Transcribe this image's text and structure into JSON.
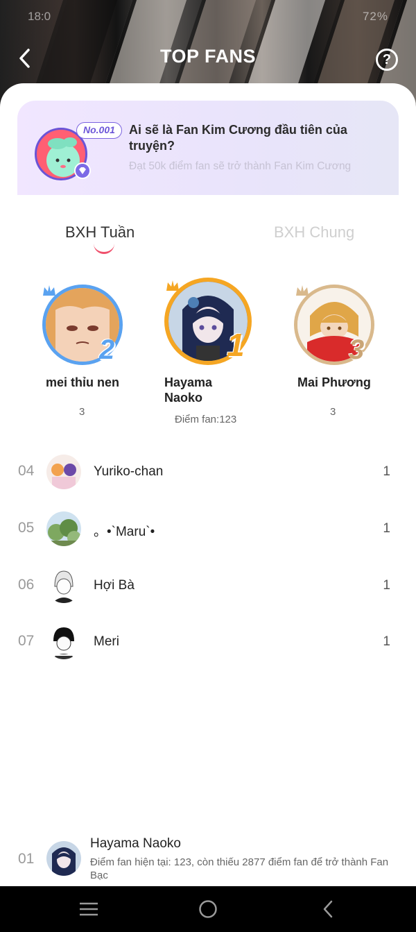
{
  "status_bar": {
    "time": "18:0",
    "right": "72%"
  },
  "header": {
    "title": "TOP FANS",
    "help_glyph": "?"
  },
  "banner": {
    "badge": "No.001",
    "title": "Ai sẽ là Fan Kim Cương đầu tiên của truyện?",
    "subtitle": "Đạt 50k điểm fan sẽ trở thành Fan Kim Cương"
  },
  "tabs": [
    {
      "label": "BXH Tuần",
      "active": true
    },
    {
      "label": "BXH Chung",
      "active": false
    }
  ],
  "podium": [
    {
      "rank": "2",
      "name": "mei thỉu nen",
      "score": "3",
      "ring_color": "#5aa2f0",
      "crown_color": "#5aa2f0"
    },
    {
      "rank": "1",
      "name": "Hayama Naoko",
      "score": "Điểm fan:123",
      "ring_color": "#f5a623",
      "crown_color": "#f5a623"
    },
    {
      "rank": "3",
      "name": "Mai Phương",
      "score": "3",
      "ring_color": "#d9b98c",
      "crown_color": "#d9b98c"
    }
  ],
  "list": [
    {
      "rank": "04",
      "name": "Yuriko-chan",
      "score": "1"
    },
    {
      "rank": "05",
      "name": "。•`Maru`•",
      "score": "1"
    },
    {
      "rank": "06",
      "name": "Hợi Bà",
      "score": "1"
    },
    {
      "rank": "07",
      "name": "Meri",
      "score": "1"
    }
  ],
  "current_user": {
    "rank": "01",
    "name": "Hayama Naoko",
    "info": "Điểm fan hiện tại: 123, còn thiếu 2877 điểm fan để trở thành Fan Bạc"
  },
  "colors": {
    "accent": "#ef4f6b",
    "banner_purple": "#6c56d8"
  },
  "icons": [
    "back-arrow-icon",
    "help-icon",
    "diamond-icon",
    "crown-icon",
    "menu-icon",
    "home-icon",
    "nav-back-icon"
  ]
}
